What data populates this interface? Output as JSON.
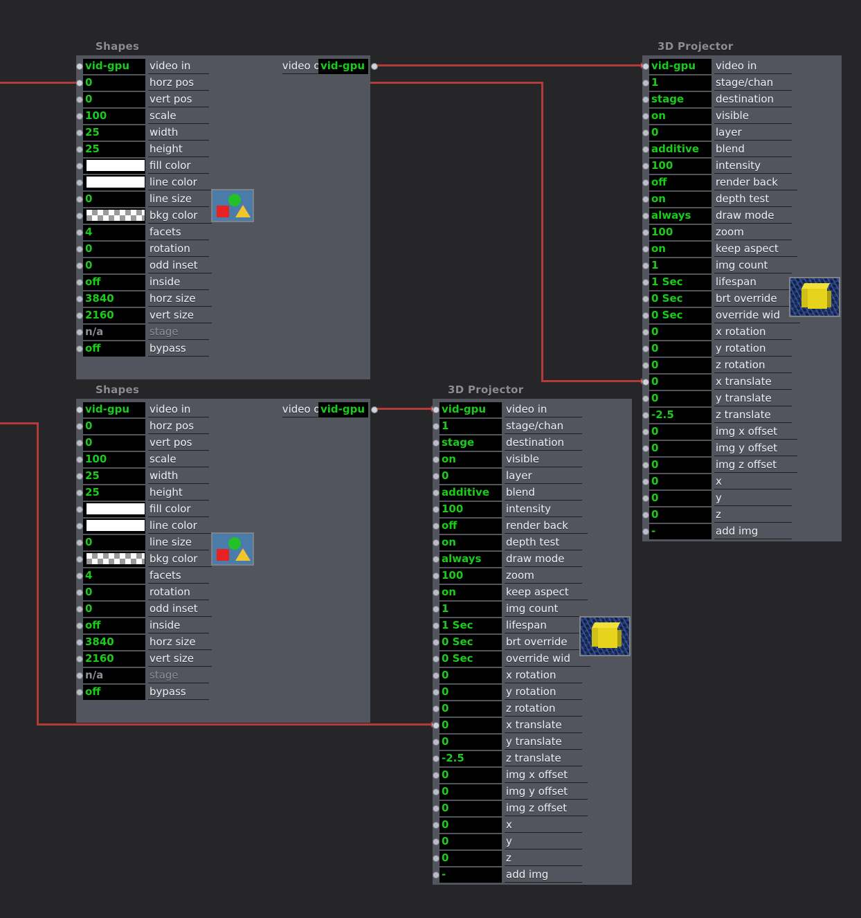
{
  "canvas": {
    "background": "#262628",
    "panel_color": "#53555e",
    "wire_color": "#b33b3b",
    "value_color": "#19cc19",
    "label_color": "#eef2f7"
  },
  "nodes": [
    {
      "id": "shapes-top",
      "title": "Shapes",
      "output": {
        "label": "video out",
        "value": "vid-gpu"
      },
      "rows": [
        {
          "value": "vid-gpu",
          "label": "video in"
        },
        {
          "value": "0",
          "label": "horz pos"
        },
        {
          "value": "0",
          "label": "vert pos"
        },
        {
          "value": "100",
          "label": "scale"
        },
        {
          "value": "25",
          "label": "width"
        },
        {
          "value": "25",
          "label": "height"
        },
        {
          "value": "",
          "label": "fill color",
          "swatch": "white"
        },
        {
          "value": "",
          "label": "line color",
          "swatch": "white"
        },
        {
          "value": "0",
          "label": "line size"
        },
        {
          "value": "",
          "label": "bkg color",
          "swatch": "checker"
        },
        {
          "value": "4",
          "label": "facets"
        },
        {
          "value": "0",
          "label": "rotation"
        },
        {
          "value": "0",
          "label": "odd inset"
        },
        {
          "value": "off",
          "label": "inside"
        },
        {
          "value": "3840",
          "label": "horz size"
        },
        {
          "value": "2160",
          "label": "vert size"
        },
        {
          "value": "n/a",
          "label": "stage",
          "dim": true
        },
        {
          "value": "off",
          "label": "bypass"
        }
      ]
    },
    {
      "id": "projector-top",
      "title": "3D Projector",
      "rows": [
        {
          "value": "vid-gpu",
          "label": "video in"
        },
        {
          "value": "1",
          "label": "stage/chan"
        },
        {
          "value": "stage",
          "label": "destination"
        },
        {
          "value": "on",
          "label": "visible"
        },
        {
          "value": "0",
          "label": "layer"
        },
        {
          "value": "additive",
          "label": "blend"
        },
        {
          "value": "100",
          "label": "intensity"
        },
        {
          "value": "off",
          "label": "render back"
        },
        {
          "value": "on",
          "label": "depth test"
        },
        {
          "value": "always",
          "label": "draw mode"
        },
        {
          "value": "100",
          "label": "zoom"
        },
        {
          "value": "on",
          "label": "keep aspect"
        },
        {
          "value": "1",
          "label": "img count"
        },
        {
          "value": "1 Sec",
          "label": "lifespan"
        },
        {
          "value": "0 Sec",
          "label": "brt override"
        },
        {
          "value": "0 Sec",
          "label": "override wid"
        },
        {
          "value": "0",
          "label": "x rotation"
        },
        {
          "value": "0",
          "label": "y rotation"
        },
        {
          "value": "0",
          "label": "z rotation"
        },
        {
          "value": "0",
          "label": "x translate"
        },
        {
          "value": "0",
          "label": "y translate"
        },
        {
          "value": "-2.5",
          "label": "z translate"
        },
        {
          "value": "0",
          "label": "img x offset"
        },
        {
          "value": "0",
          "label": "img y offset"
        },
        {
          "value": "0",
          "label": "img z offset"
        },
        {
          "value": "0",
          "label": "x"
        },
        {
          "value": "0",
          "label": "y"
        },
        {
          "value": "0",
          "label": "z"
        },
        {
          "value": "-",
          "label": "add img"
        }
      ]
    },
    {
      "id": "shapes-bottom",
      "title": "Shapes",
      "output": {
        "label": "video out",
        "value": "vid-gpu"
      },
      "rows": [
        {
          "value": "vid-gpu",
          "label": "video in"
        },
        {
          "value": "0",
          "label": "horz pos"
        },
        {
          "value": "0",
          "label": "vert pos"
        },
        {
          "value": "100",
          "label": "scale"
        },
        {
          "value": "25",
          "label": "width"
        },
        {
          "value": "25",
          "label": "height"
        },
        {
          "value": "",
          "label": "fill color",
          "swatch": "white"
        },
        {
          "value": "",
          "label": "line color",
          "swatch": "white"
        },
        {
          "value": "0",
          "label": "line size"
        },
        {
          "value": "",
          "label": "bkg color",
          "swatch": "checker"
        },
        {
          "value": "4",
          "label": "facets"
        },
        {
          "value": "0",
          "label": "rotation"
        },
        {
          "value": "0",
          "label": "odd inset"
        },
        {
          "value": "off",
          "label": "inside"
        },
        {
          "value": "3840",
          "label": "horz size"
        },
        {
          "value": "2160",
          "label": "vert size"
        },
        {
          "value": "n/a",
          "label": "stage",
          "dim": true
        },
        {
          "value": "off",
          "label": "bypass"
        }
      ]
    },
    {
      "id": "projector-bottom",
      "title": "3D Projector",
      "rows": [
        {
          "value": "vid-gpu",
          "label": "video in"
        },
        {
          "value": "1",
          "label": "stage/chan"
        },
        {
          "value": "stage",
          "label": "destination"
        },
        {
          "value": "on",
          "label": "visible"
        },
        {
          "value": "0",
          "label": "layer"
        },
        {
          "value": "additive",
          "label": "blend"
        },
        {
          "value": "100",
          "label": "intensity"
        },
        {
          "value": "off",
          "label": "render back"
        },
        {
          "value": "on",
          "label": "depth test"
        },
        {
          "value": "always",
          "label": "draw mode"
        },
        {
          "value": "100",
          "label": "zoom"
        },
        {
          "value": "on",
          "label": "keep aspect"
        },
        {
          "value": "1",
          "label": "img count"
        },
        {
          "value": "1 Sec",
          "label": "lifespan"
        },
        {
          "value": "0 Sec",
          "label": "brt override"
        },
        {
          "value": "0 Sec",
          "label": "override wid"
        },
        {
          "value": "0",
          "label": "x rotation"
        },
        {
          "value": "0",
          "label": "y rotation"
        },
        {
          "value": "0",
          "label": "z rotation"
        },
        {
          "value": "0",
          "label": "x translate"
        },
        {
          "value": "0",
          "label": "y translate"
        },
        {
          "value": "-2.5",
          "label": "z translate"
        },
        {
          "value": "0",
          "label": "img x offset"
        },
        {
          "value": "0",
          "label": "img y offset"
        },
        {
          "value": "0",
          "label": "img z offset"
        },
        {
          "value": "0",
          "label": "x"
        },
        {
          "value": "0",
          "label": "y"
        },
        {
          "value": "0",
          "label": "z"
        },
        {
          "value": "-",
          "label": "add img"
        }
      ]
    }
  ],
  "thumbnails": {
    "shapes_icon": "shapes-preview-thumbnail",
    "cube_icon": "cube-preview-thumbnail"
  }
}
